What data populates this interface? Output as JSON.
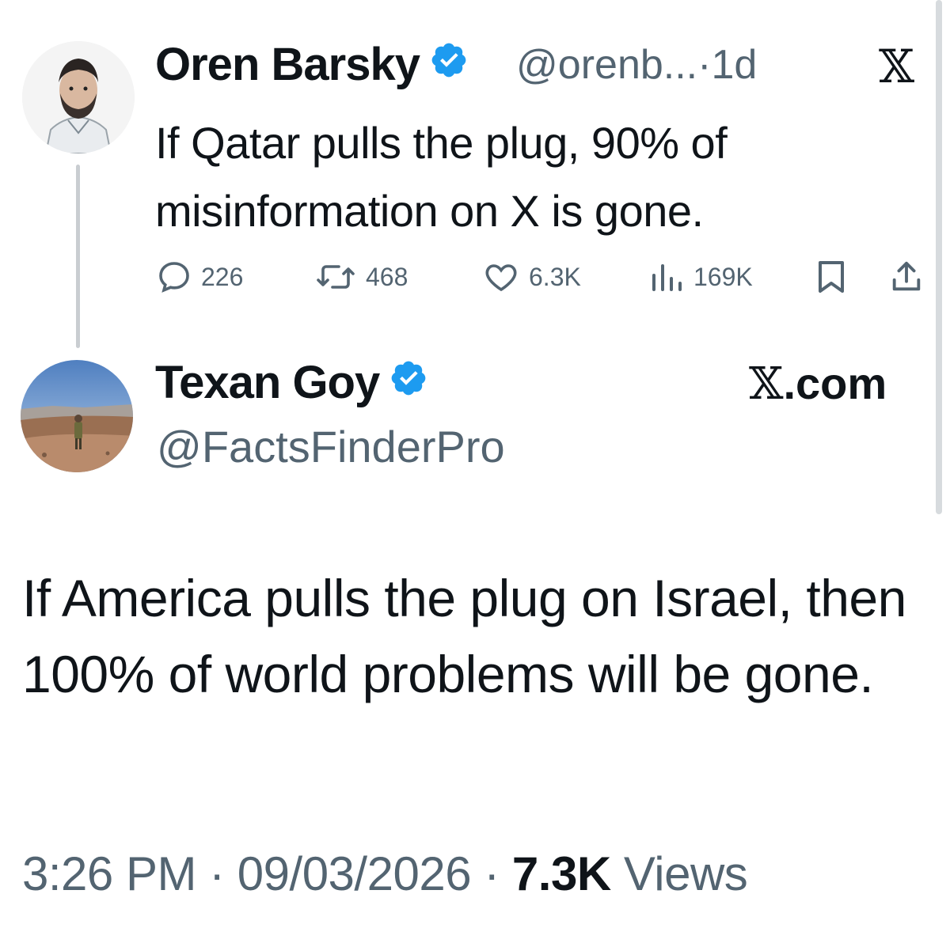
{
  "parent_tweet": {
    "name": "Oren Barsky",
    "handle": "@orenb...",
    "separator": "·",
    "age": "1d",
    "platform_icon": "x-logo-icon",
    "text": "If Qatar pulls the plug, 90% of misinformation on X is gone.",
    "actions": {
      "replies": "226",
      "reposts": "468",
      "likes": "6.3K",
      "views": "169K"
    }
  },
  "reply_tweet": {
    "name": "Texan Goy",
    "handle": "@FactsFinderPro",
    "source_x": "𝕏",
    "source_rest": ".com",
    "text": "If America pulls the plug on Israel, then 100% of world problems will be gone.",
    "time": "3:26 PM",
    "dot1": " · ",
    "date": "09/03/2026",
    "dot2": " · ",
    "views_count": "7.3K",
    "views_label": " Views"
  },
  "colors": {
    "verified_blue": "#1d9bf0",
    "secondary_text": "#536471",
    "primary_text": "#0f1419"
  }
}
